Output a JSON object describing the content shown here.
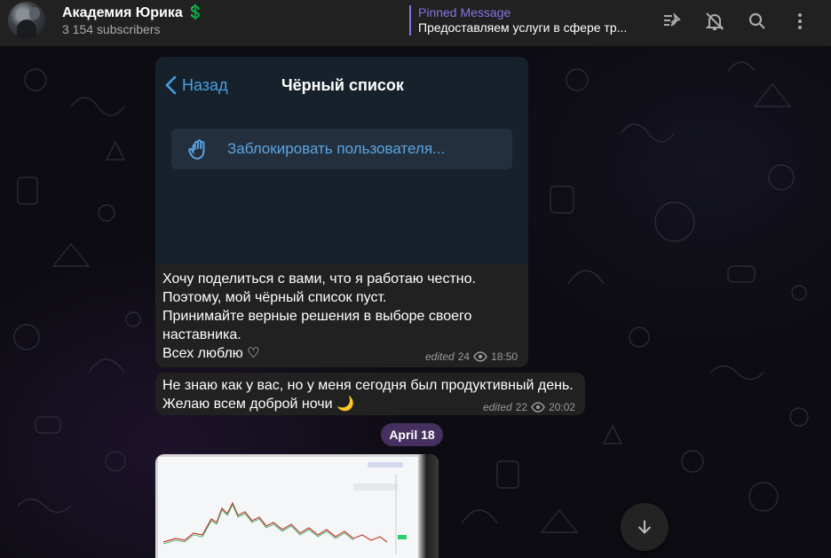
{
  "header": {
    "channel_title": "Академия Юрика 💲",
    "subscribers": "3 154 subscribers",
    "pinned_label": "Pinned Message",
    "pinned_text": "Предоставляем услуги в сфере тр...",
    "icons": [
      "pin-list-icon",
      "mute-bell-icon",
      "search-icon",
      "more-vertical-icon"
    ]
  },
  "messages": [
    {
      "screenshot": {
        "back_label": "Назад",
        "title": "Чёрный список",
        "block_button": "Заблокировать пользователя..."
      },
      "lines": [
        "Хочу поделиться с вами, что я работаю честно.",
        "Поэтому, мой чёрный список пуст.",
        "Принимайте верные решения в выборе своего",
        "наставника.",
        "Всех люблю ♡"
      ],
      "edited": "edited",
      "views": "24",
      "time": "18:50"
    },
    {
      "lines": [
        "Не знаю как у вас, но у меня сегодня был продуктивный день.",
        "Желаю всем доброй ночи 🌙"
      ],
      "edited": "edited",
      "views": "22",
      "time": "20:02"
    }
  ],
  "date_separator": "April 18",
  "colors": {
    "accent": "#8774e1",
    "header_bg": "#212121",
    "bubble_bg": "#212121",
    "link_blue": "#5aa5e3",
    "date_pill": "#45305f"
  }
}
